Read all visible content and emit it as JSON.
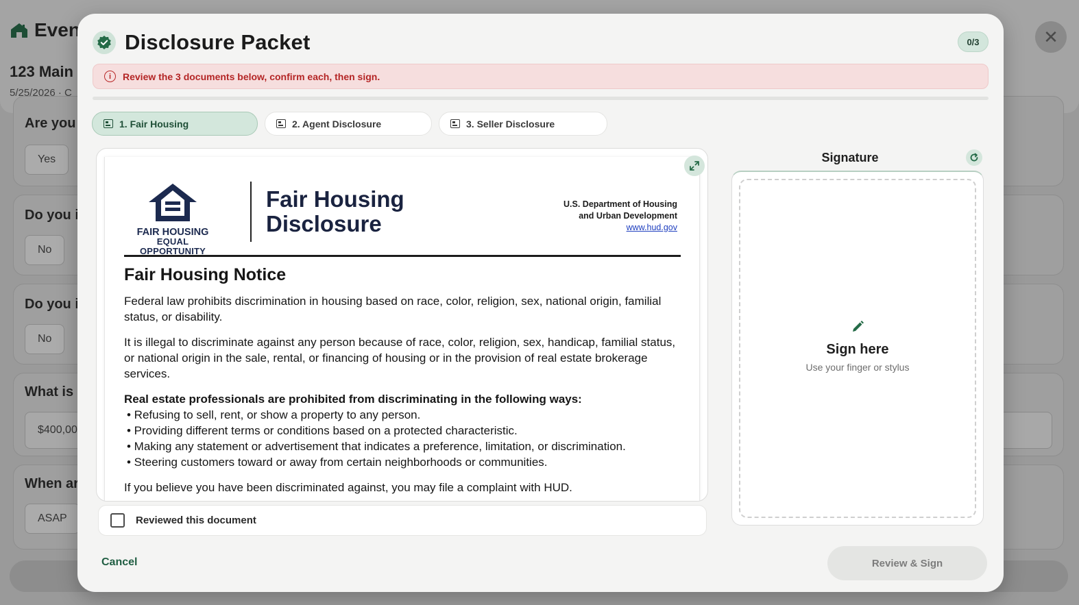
{
  "background": {
    "brand": "Even",
    "title": "123 Main",
    "subtitle": "5/25/2026 · C",
    "questions": [
      {
        "q": "Are you r",
        "answer": "Yes"
      },
      {
        "q": "Do you i",
        "answer": "No"
      },
      {
        "q": "Do you i",
        "answer": "No"
      },
      {
        "q": "What is r",
        "answer": "$400,00"
      },
      {
        "q": "When ar",
        "answer": "ASAP"
      }
    ]
  },
  "modal": {
    "title": "Disclosure Packet",
    "count": "0/3",
    "progress_fraction": 0,
    "alert": "Review the 3 documents below, confirm each, then sign.",
    "tabs": [
      {
        "label": "1. Fair Housing",
        "active": true
      },
      {
        "label": "2. Agent Disclosure",
        "active": false
      },
      {
        "label": "3. Seller Disclosure",
        "active": false
      }
    ],
    "document": {
      "logo_line1": "FAIR HOUSING",
      "logo_line2": "EQUAL OPPORTUNITY",
      "heading_line1": "Fair Housing",
      "heading_line2": "Disclosure",
      "agency_line1": "U.S. Department of Housing",
      "agency_line2": "and Urban Development",
      "agency_url": "www.hud.gov",
      "section_title": "Fair Housing Notice",
      "para1": "Federal law prohibits discrimination in housing based on race, color, religion, sex, national origin, familial status, or disability.",
      "para2": "It is illegal to discriminate against any person because of race, color, religion, sex, handicap, familial status, or national origin in the sale, rental, or financing of housing or in the provision of real estate brokerage services.",
      "list_title": "Real estate professionals are prohibited from discriminating in the following ways:",
      "list_items": [
        "• Refusing to sell, rent, or show a property to any person.",
        "• Providing different terms or conditions based on a protected characteristic.",
        "• Making any statement or advertisement that indicates a preference, limitation, or discrimination.",
        "• Steering customers toward or away from certain neighborhoods or communities."
      ],
      "para3": "If you believe you have been discriminated against, you may file a complaint with HUD."
    },
    "reviewed_label": "Reviewed this document",
    "reviewed_checked": false,
    "signature": {
      "title": "Signature",
      "sign_here": "Sign here",
      "hint": "Use your finger or stylus"
    },
    "cancel_label": "Cancel",
    "review_sign_label": "Review & Sign"
  },
  "colors": {
    "accent": "#2d7a52",
    "alert_text": "#b42525",
    "alert_bg": "#f6dede",
    "active_tab_bg": "#d3e7dc"
  }
}
